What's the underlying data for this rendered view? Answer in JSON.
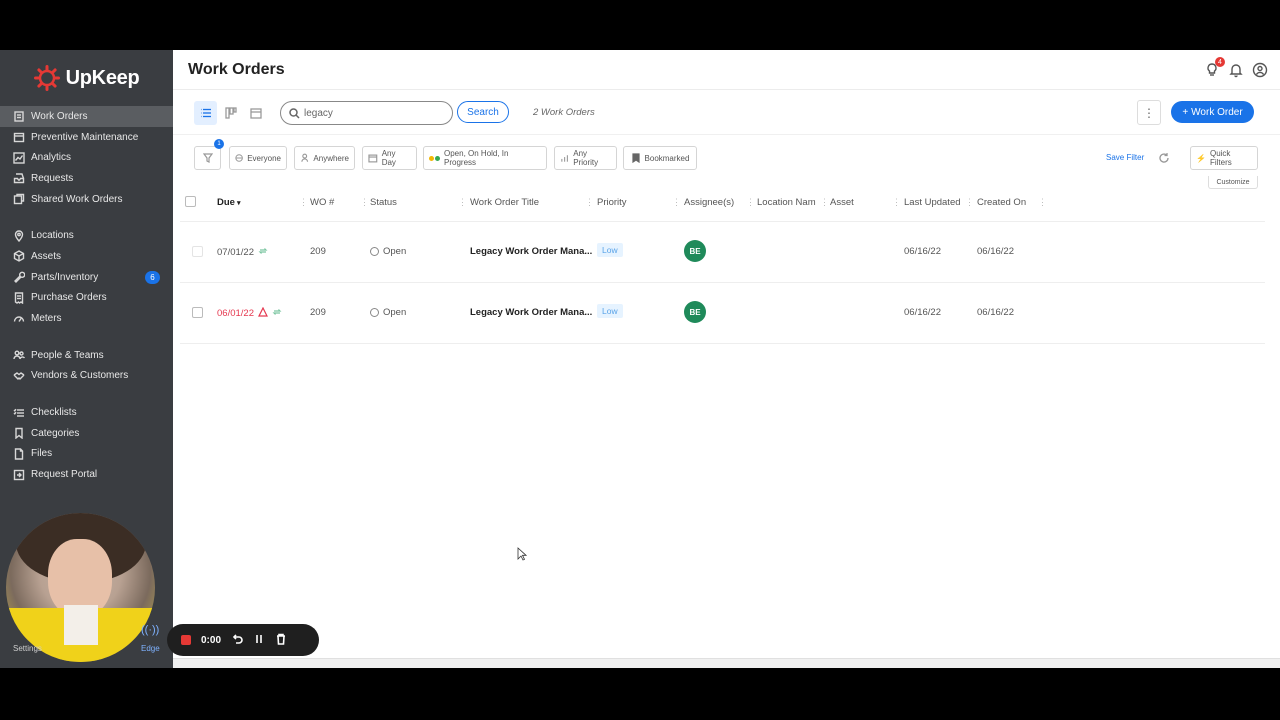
{
  "brand": {
    "name": "UpKeep",
    "accent": "#e53935"
  },
  "sidebar": {
    "groups": [
      [
        {
          "label": "Work Orders",
          "icon": "clipboard-icon",
          "active": true
        },
        {
          "label": "Preventive Maintenance",
          "icon": "calendar-icon"
        },
        {
          "label": "Analytics",
          "icon": "chart-icon"
        },
        {
          "label": "Requests",
          "icon": "inbox-icon"
        },
        {
          "label": "Shared Work Orders",
          "icon": "share-icon"
        }
      ],
      [
        {
          "label": "Locations",
          "icon": "pin-icon"
        },
        {
          "label": "Assets",
          "icon": "cube-icon"
        },
        {
          "label": "Parts/Inventory",
          "icon": "wrench-icon",
          "badge": "6"
        },
        {
          "label": "Purchase Orders",
          "icon": "receipt-icon"
        },
        {
          "label": "Meters",
          "icon": "gauge-icon"
        }
      ],
      [
        {
          "label": "People & Teams",
          "icon": "people-icon"
        },
        {
          "label": "Vendors & Customers",
          "icon": "handshake-icon"
        }
      ],
      [
        {
          "label": "Checklists",
          "icon": "list-icon"
        },
        {
          "label": "Categories",
          "icon": "bookmark-icon"
        },
        {
          "label": "Files",
          "icon": "file-icon"
        },
        {
          "label": "Request Portal",
          "icon": "portal-icon"
        }
      ]
    ],
    "settings_label": "Settings",
    "edge_label": "Edge"
  },
  "header": {
    "title": "Work Orders",
    "notification_badge": "4"
  },
  "toolbar": {
    "search_value": "legacy",
    "search_button": "Search",
    "count_text": "2 Work Orders",
    "new_button": "Work Order"
  },
  "filters": {
    "badge": "1",
    "chips": [
      "Everyone",
      "Anywhere",
      "Any Day",
      "Open, On Hold, In Progress",
      "Any Priority",
      "Bookmarked"
    ],
    "save_filter": "Save Filter",
    "quick_filters": "Quick Filters",
    "customize": "Customize"
  },
  "table": {
    "columns": [
      "Due",
      "WO #",
      "Status",
      "Work Order Title",
      "Priority",
      "Assignee(s)",
      "Location Nam",
      "Asset",
      "Last Updated",
      "Created On"
    ],
    "rows": [
      {
        "due": "07/01/22",
        "overdue": false,
        "wo": "209",
        "status": "Open",
        "title": "Legacy Work Order Mana...",
        "priority": "Low",
        "assignee": "BE",
        "last_updated": "06/16/22",
        "created_on": "06/16/22"
      },
      {
        "due": "06/01/22",
        "overdue": true,
        "wo": "209",
        "status": "Open",
        "title": "Legacy Work Order Mana...",
        "priority": "Low",
        "assignee": "BE",
        "last_updated": "06/16/22",
        "created_on": "06/16/22"
      }
    ]
  },
  "recorder": {
    "time": "0:00"
  }
}
